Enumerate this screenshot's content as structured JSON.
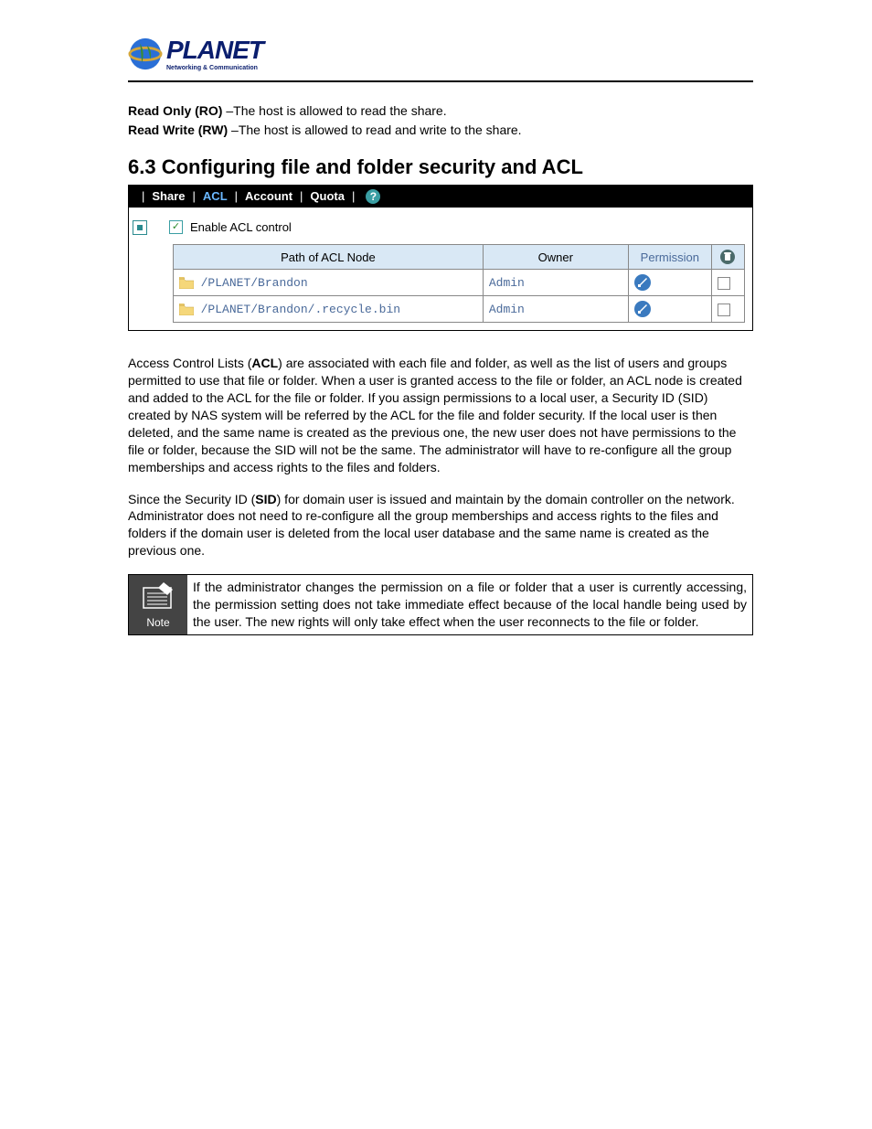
{
  "logo": {
    "name": "PLANET",
    "tagline": "Networking & Communication"
  },
  "intro": {
    "ro_label": "Read Only (RO)",
    "ro_text": " –The host is allowed to read the share.",
    "rw_label": "Read Write (RW)",
    "rw_text": " –The host is allowed to read and write to the share."
  },
  "heading": "6.3 Configuring file and folder security and ACL",
  "tabs": {
    "share": "Share",
    "acl": "ACL",
    "account": "Account",
    "quota": "Quota"
  },
  "enable_label": "Enable ACL control",
  "table": {
    "headers": {
      "path": "Path of ACL Node",
      "owner": "Owner",
      "permission": "Permission"
    },
    "rows": [
      {
        "path": "/PLANET/Brandon",
        "owner": "Admin"
      },
      {
        "path": "/PLANET/Brandon/.recycle.bin",
        "owner": "Admin"
      }
    ]
  },
  "para1_a": "Access Control Lists (",
  "para1_b": "ACL",
  "para1_c": ") are associated with each file and folder, as well as the list of users and groups permitted to use that file or folder. When a user is granted access to the file or folder, an ACL node is created and added to the ACL for the file or folder. If you assign permissions to a local user, a Security ID (SID) created by NAS system will be referred by the ACL for the file and folder security. If the local user is then deleted, and the same name is created as the previous one, the new user does not have permissions to the file or folder, because the SID will not be the same. The administrator will have to re-configure all the group memberships and access rights to the files and folders.",
  "para2_a": "Since the Security ID (",
  "para2_b": "SID",
  "para2_c": ") for domain user is issued and maintain by the domain controller on the network. Administrator does not need to re-configure all the group memberships and access rights to the files and folders if the domain user is deleted from the local user database and the same name is created as the previous one.",
  "note": {
    "label": "Note",
    "text": "If the administrator changes the permission on a file or folder that a user is currently accessing, the permission setting does not take immediate effect because of the local handle being used by the user. The new rights will only take effect when the user reconnects to the file or folder."
  }
}
